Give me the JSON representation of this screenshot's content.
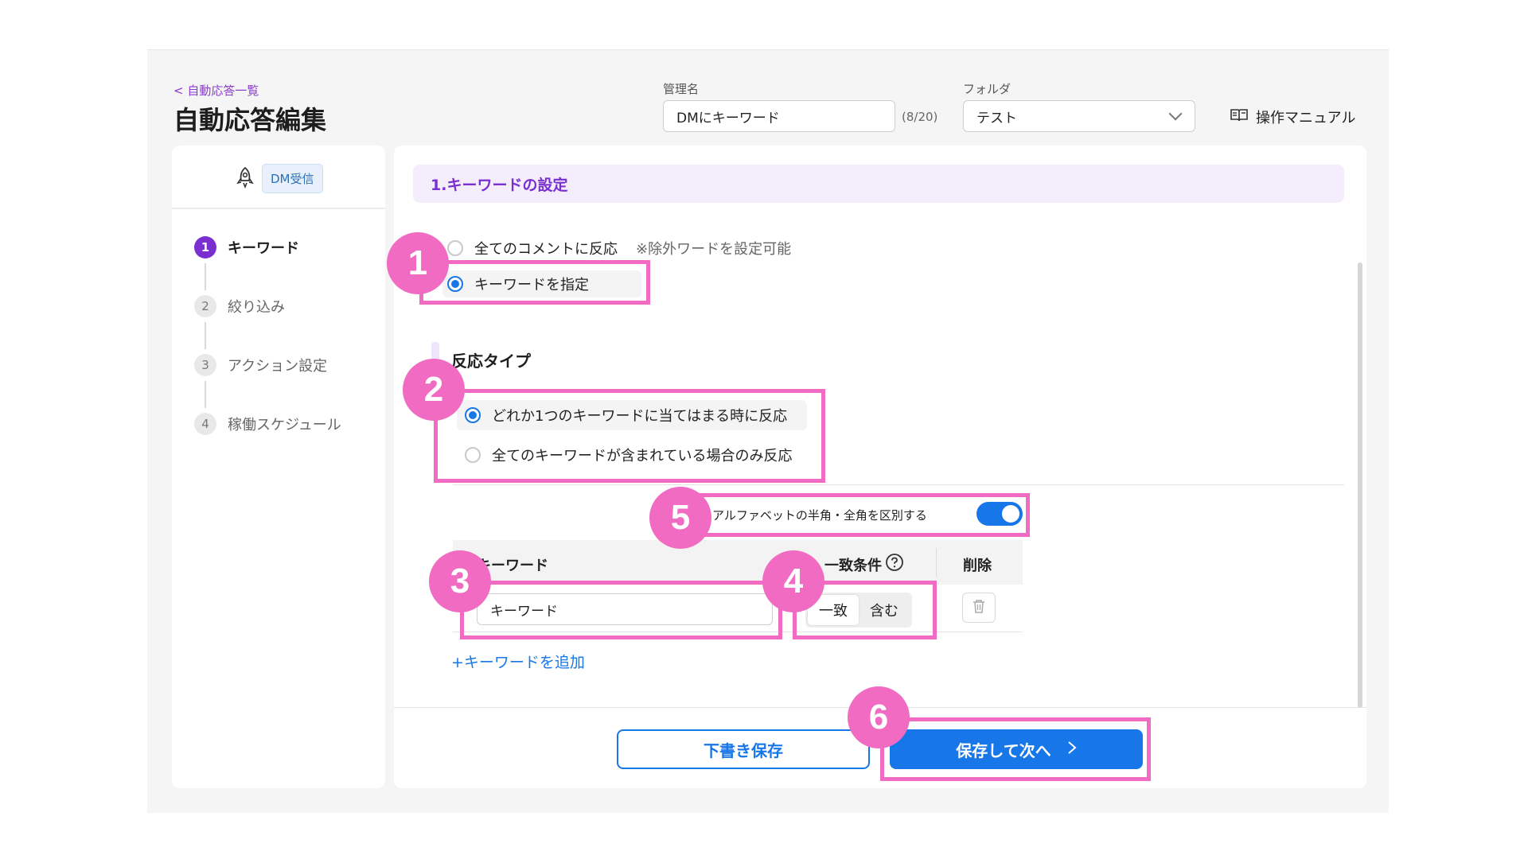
{
  "header": {
    "back_link": "< 自動応答一覧",
    "title": "自動応答編集",
    "name_label": "管理名",
    "name_value": "DMにキーワード",
    "name_counter": "(8/20)",
    "folder_label": "フォルダ",
    "folder_value": "テスト",
    "manual_label": "操作マニュアル"
  },
  "sidebar": {
    "trigger_badge": "DM受信",
    "steps": [
      {
        "num": "1",
        "label": "キーワード",
        "active": true
      },
      {
        "num": "2",
        "label": "絞り込み",
        "active": false
      },
      {
        "num": "3",
        "label": "アクション設定",
        "active": false
      },
      {
        "num": "4",
        "label": "稼働スケジュール",
        "active": false
      }
    ]
  },
  "main": {
    "section_title": "1.キーワードの設定",
    "scope_options": [
      {
        "label": "全てのコメントに反応",
        "selected": false
      },
      {
        "label": "キーワードを指定",
        "selected": true
      }
    ],
    "scope_note": "※除外ワードを設定可能",
    "reaction_heading": "反応タイプ",
    "reaction_options": [
      {
        "label": "どれか1つのキーワードに当てはまる時に反応",
        "selected": true
      },
      {
        "label": "全てのキーワードが含まれている場合のみ反応",
        "selected": false
      }
    ],
    "toggle_label": "アルファベットの半角・全角を区別する",
    "toggle_on": true,
    "table": {
      "col_keyword": "キーワード",
      "col_match": "一致条件",
      "col_delete": "削除",
      "row_keyword_placeholder": "キーワード",
      "match_options": [
        "一致",
        "含む"
      ],
      "match_selected": "一致"
    },
    "add_keyword": "+キーワードを追加"
  },
  "footer": {
    "draft_button": "下書き保存",
    "next_button": "保存して次へ"
  },
  "annotations": [
    "1",
    "2",
    "3",
    "4",
    "5",
    "6"
  ],
  "colors": {
    "accent_purple": "#7a2fd0",
    "primary_blue": "#1877e8",
    "highlight_pink": "#f26bc2"
  }
}
